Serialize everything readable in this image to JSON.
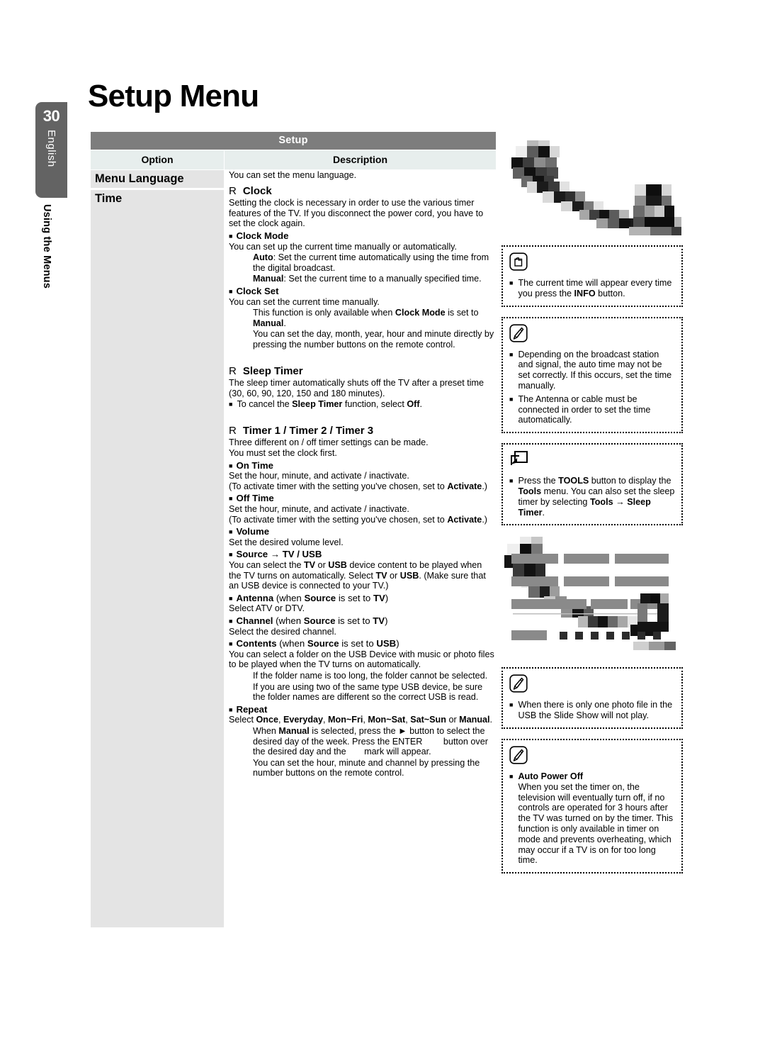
{
  "sidebar": {
    "page_number": "30",
    "language": "English",
    "chapter": "Using the Menus"
  },
  "page_title": "Setup Menu",
  "table": {
    "title": "Setup",
    "columns": [
      "Option",
      "Description"
    ],
    "rows": [
      {
        "option": "Menu Language",
        "description": "You can set the menu language."
      },
      {
        "option": "Time",
        "description": "Clock / Sleep Timer / Timer 1 / Timer 2 / Timer 3"
      }
    ]
  },
  "content": {
    "clock": {
      "marker": "R",
      "heading": "Clock",
      "intro": "Setting the clock is necessary in order to use the various timer features of the TV. If you disconnect the power cord, you have to set the clock again.",
      "clock_mode_head": "Clock Mode",
      "clock_mode_line": "You can set up the current time manually or automatically.",
      "auto_label": "Auto",
      "auto_text": ": Set the current time automatically using the time from the digital broadcast.",
      "manual_label": "Manual",
      "manual_text": ": Set the current time to a manually specified time.",
      "clock_set_head": "Clock Set",
      "clock_set_line": "You can set the current time manually.",
      "clock_set_note1_a": "This function is only available when ",
      "clock_set_note1_b": "Clock Mode",
      "clock_set_note1_c": " is set to ",
      "clock_set_note1_d": "Manual",
      "clock_set_note1_e": ".",
      "clock_set_note2": "You can set the day, month, year, hour and minute directly by pressing the number buttons on the remote control."
    },
    "sleep_timer": {
      "marker": "R",
      "heading": "Sleep Timer",
      "intro": "The sleep timer automatically shuts off the TV after a preset time (30, 60, 90, 120, 150 and 180 minutes).",
      "cancel_a": "To cancel the ",
      "cancel_b": "Sleep Timer",
      "cancel_c": " function, select ",
      "cancel_d": "Off",
      "cancel_e": "."
    },
    "timers": {
      "marker": "R",
      "heading": "Timer 1 / Timer 2 / Timer 3",
      "intro1": "Three different on / off timer settings can be made.",
      "intro2": "You must set the clock first.",
      "on_time_head": "On Time",
      "on_time_line1": "Set the hour, minute, and activate / inactivate.",
      "on_time_line2a": "(To activate timer with the setting you've chosen, set to ",
      "on_time_line2b": "Activate",
      "on_time_line2c": ".)",
      "off_time_head": "Off Time",
      "off_time_line1": "Set the hour, minute, and activate / inactivate.",
      "off_time_line2a": "(To activate timer with the setting you've chosen, set to ",
      "off_time_line2b": "Activate",
      "off_time_line2c": ".)",
      "volume_head": "Volume",
      "volume_line": "Set the desired volume level.",
      "source_head_a": "Source",
      "source_head_arrow": "→",
      "source_head_b": "TV / USB",
      "source_line_1": "You can select the ",
      "source_line_2": "TV",
      "source_line_3": " or ",
      "source_line_4": "USB",
      "source_line_5": " device content to be played when the TV turns on automatically. Select ",
      "source_line_6": "TV",
      "source_line_7": " or ",
      "source_line_8": "USB",
      "source_line_9": ". (Make sure that an USB device is connected to your TV.)",
      "antenna_head_a": "Antenna",
      "antenna_head_b": " (when ",
      "antenna_head_c": "Source",
      "antenna_head_d": " is set to ",
      "antenna_head_e": "TV",
      "antenna_head_f": ")",
      "antenna_line": "Select ATV or DTV.",
      "channel_head_a": "Channel",
      "channel_head_b": " (when ",
      "channel_head_c": "Source",
      "channel_head_d": " is set to ",
      "channel_head_e": "TV",
      "channel_head_f": ")",
      "channel_line": "Select the desired channel.",
      "contents_head_a": "Contents",
      "contents_head_b": " (when ",
      "contents_head_c": "Source",
      "contents_head_d": " is set to ",
      "contents_head_e": "USB",
      "contents_head_f": ")",
      "contents_line": "You can select a folder on the USB Device with music or photo files to be played when the TV turns on automatically.",
      "contents_note1": "If the folder name is too long, the folder cannot be selected.",
      "contents_note2": "If you are using two of the same type USB device, be sure the folder names are different so the correct USB is read.",
      "repeat_head": "Repeat",
      "repeat_line_sel": "Select ",
      "repeat_opt1": "Once",
      "repeat_opt2": "Everyday",
      "repeat_opt3": "Mon~Fri",
      "repeat_opt4": "Mon~Sat",
      "repeat_opt5": "Sat~Sun",
      "repeat_or": " or ",
      "repeat_opt6": "Manual",
      "repeat_period": ".",
      "repeat_note1_a": "When ",
      "repeat_note1_b": "Manual",
      "repeat_note1_c": " is selected, press the ",
      "repeat_note1_arrow": "►",
      "repeat_note1_d": " button to select the desired day of the week. Press the ENTER",
      "repeat_note1_e": " button over the desired day and the",
      "repeat_note1_f": " mark will appear.",
      "repeat_note2": "You can set the hour, minute and channel by pressing the number buttons on the remote control."
    }
  },
  "notes": [
    {
      "icon": "hand-press-icon",
      "items": [
        {
          "pre": "The current time will appear every time you press the ",
          "bold": "INFO",
          "post": " button."
        }
      ]
    },
    {
      "icon": "note-pencil-icon",
      "items": [
        {
          "pre": "Depending on the broadcast station and signal, the auto time may not be set correctly. If this occurs, set the time manually.",
          "bold": "",
          "post": ""
        },
        {
          "pre": "The Antenna or cable must be connected in order to set the time automatically.",
          "bold": "",
          "post": ""
        }
      ]
    },
    {
      "icon": "tools-cursor-icon",
      "items": [
        {
          "pre": "Press the ",
          "bold": "TOOLS",
          "post": " button to display the Tools menu. You can also set the sleep timer by selecting Tools → Sleep Timer."
        }
      ]
    },
    {
      "icon": "note-pencil-icon",
      "items": [
        {
          "pre": "When there is only one photo file in the USB the Slide Show will not play.",
          "bold": "",
          "post": ""
        }
      ]
    },
    {
      "icon": "note-pencil-icon",
      "items": [
        {
          "pre": "",
          "bold": "Auto Power Off",
          "post": ""
        }
      ]
    }
  ],
  "note_tools": {
    "press_the": "Press the ",
    "tools_btn": "TOOLS",
    "button_to_display": " button to display the ",
    "tools_menu": "Tools",
    "menu_you": " menu. You can also set the sleep timer by selecting ",
    "tools_word": "Tools",
    "arrow": " → ",
    "sleep_timer_word": "Sleep Timer",
    "period": "."
  },
  "note_info": {
    "pre": "The current time will appear every time you press the ",
    "bold": "INFO",
    "post": " button."
  },
  "note_broadcast": {
    "item1": "Depending on the broadcast station and signal, the auto time may not be set correctly. If this occurs, set the time manually.",
    "item2": "The Antenna or cable must be connected in order to set the time automatically."
  },
  "note_slideshow": {
    "item1": "When there is only one photo file in the USB the Slide Show will not play."
  },
  "note_autopower": {
    "title": "Auto Power Off",
    "body": "When you set the timer on, the television will eventually turn off, if no controls are operated for 3 hours after the TV was turned on by the timer. This function is only available in timer on mode and prevents overheating, which may occur if a TV is on for too long time."
  },
  "colors": {
    "table_header_bg": "#7d7d7d",
    "col_header_bg": "#e7eeed",
    "option_cell_bg": "#e4e4e4",
    "sidebar_tab_bg": "#636363"
  }
}
